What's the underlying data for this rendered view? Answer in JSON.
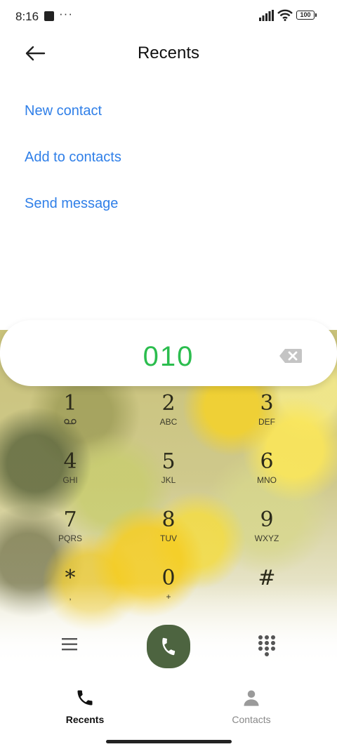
{
  "status_bar": {
    "time": "8:16",
    "more": "···",
    "battery": "100"
  },
  "header": {
    "title": "Recents"
  },
  "actions": {
    "new_contact": "New contact",
    "add_to_contacts": "Add to contacts",
    "send_message": "Send message"
  },
  "dialer": {
    "number": "010",
    "keys": [
      {
        "digit": "1",
        "letters": ""
      },
      {
        "digit": "2",
        "letters": "ABC"
      },
      {
        "digit": "3",
        "letters": "DEF"
      },
      {
        "digit": "4",
        "letters": "GHI"
      },
      {
        "digit": "5",
        "letters": "JKL"
      },
      {
        "digit": "6",
        "letters": "MNO"
      },
      {
        "digit": "7",
        "letters": "PQRS"
      },
      {
        "digit": "8",
        "letters": "TUV"
      },
      {
        "digit": "9",
        "letters": "WXYZ"
      },
      {
        "digit": "*",
        "letters": ","
      },
      {
        "digit": "0",
        "letters": "+"
      },
      {
        "digit": "#",
        "letters": ""
      }
    ]
  },
  "bottom_nav": {
    "tabs": [
      {
        "label": "Recents",
        "icon": "phone-icon",
        "active": true
      },
      {
        "label": "Contacts",
        "icon": "person-icon",
        "active": false
      }
    ]
  },
  "colors": {
    "accent": "#2f7fe8",
    "number": "#2bbd4e",
    "call_button": "#4d6440"
  }
}
